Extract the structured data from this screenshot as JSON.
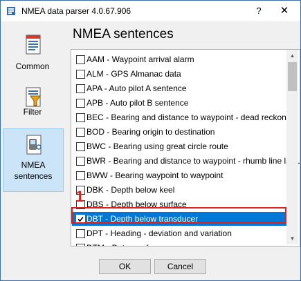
{
  "window": {
    "title": "NMEA data parser 4.0.67.906",
    "help_label": "?",
    "close_label": "✕"
  },
  "sidebar": {
    "items": [
      {
        "label": "Common",
        "icon": "document-icon"
      },
      {
        "label": "Filter",
        "icon": "filter-icon"
      },
      {
        "label": "NMEA sentences",
        "label_line1": "NMEA",
        "label_line2": "sentences",
        "icon": "gps-device-icon",
        "selected": true
      }
    ]
  },
  "main": {
    "heading": "NMEA sentences",
    "sentences": [
      {
        "code": "AAM",
        "text": "AAM - Waypoint arrival alarm",
        "checked": false
      },
      {
        "code": "ALM",
        "text": "ALM - GPS Almanac data",
        "checked": false
      },
      {
        "code": "APA",
        "text": "APA - Auto pilot A sentence",
        "checked": false
      },
      {
        "code": "APB",
        "text": "APB - Auto pilot B sentence",
        "checked": false
      },
      {
        "code": "BEC",
        "text": "BEC - Bearing and distance to waypoint - dead reckoning",
        "checked": false
      },
      {
        "code": "BOD",
        "text": "BOD - Bearing origin to destination",
        "checked": false
      },
      {
        "code": "BWC",
        "text": "BWC - Bearing using great circle route",
        "checked": false
      },
      {
        "code": "BWR",
        "text": "BWR - Bearing and distance to waypoint - rhumb line latitude",
        "checked": false
      },
      {
        "code": "BWW",
        "text": "BWW - Bearing waypoint to waypoint",
        "checked": false
      },
      {
        "code": "DBK",
        "text": "DBK - Depth below keel",
        "checked": false
      },
      {
        "code": "DBS",
        "text": "DBS - Depth below surface",
        "checked": false
      },
      {
        "code": "DBT",
        "text": "DBT - Depth below transducer",
        "checked": true,
        "selected": true
      },
      {
        "code": "DPT",
        "text": "DPT - Heading - deviation and variation",
        "checked": false
      },
      {
        "code": "DTM",
        "text": "DTM - Datum reference",
        "checked": false
      }
    ]
  },
  "annotation": {
    "number": "1",
    "color": "#e0201a"
  },
  "buttons": {
    "ok": "OK",
    "cancel": "Cancel"
  },
  "colors": {
    "selection": "#0078d7",
    "sidebar_selected": "#cce4f7",
    "highlight": "#e0201a"
  }
}
